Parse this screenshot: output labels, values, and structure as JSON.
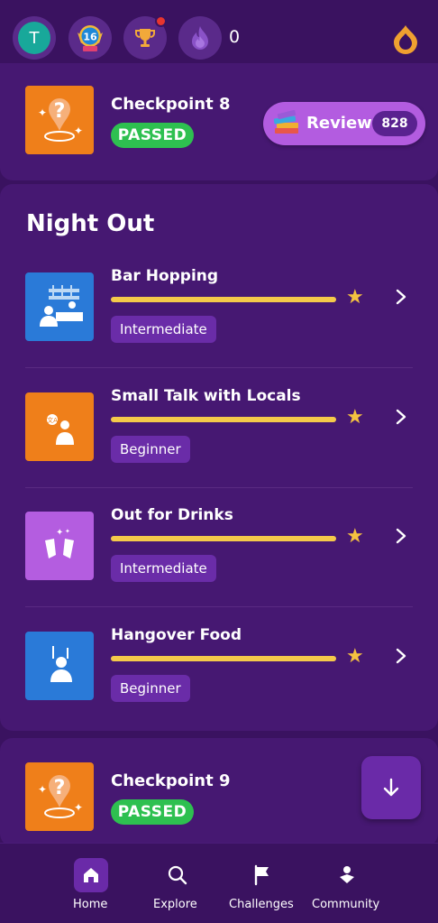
{
  "topbar": {
    "avatar_letter": "T",
    "level_badge": "16",
    "streak_count": "0"
  },
  "checkpoint_top": {
    "title": "Checkpoint 8",
    "status": "PASSED"
  },
  "review": {
    "label": "Review",
    "count": "828"
  },
  "section": {
    "title": "Night Out"
  },
  "lessons": [
    {
      "title": "Bar Hopping",
      "level": "Intermediate",
      "progress": 1.0,
      "icon_color": "#2a7ad8"
    },
    {
      "title": "Small Talk with Locals",
      "level": "Beginner",
      "progress": 1.0,
      "icon_color": "#ef7f1a"
    },
    {
      "title": "Out for Drinks",
      "level": "Intermediate",
      "progress": 1.0,
      "icon_color": "#b45de0"
    },
    {
      "title": "Hangover Food",
      "level": "Beginner",
      "progress": 1.0,
      "icon_color": "#2a7ad8"
    }
  ],
  "checkpoint_bottom": {
    "title": "Checkpoint 9",
    "status": "PASSED"
  },
  "nav": {
    "home": "Home",
    "explore": "Explore",
    "challenges": "Challenges",
    "community": "Community"
  },
  "colors": {
    "background": "#3a1260",
    "card": "#461872",
    "accent": "#b35ce0",
    "passed": "#2ec050",
    "star": "#f5c240",
    "progress": "#f5c94a"
  }
}
